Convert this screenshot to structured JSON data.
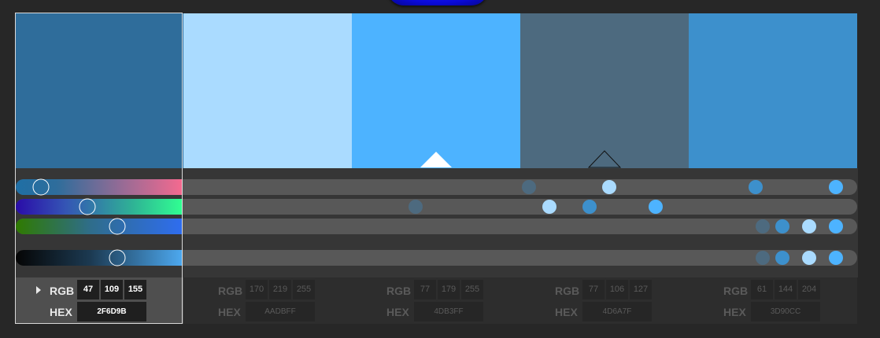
{
  "labels": {
    "rgb": "RGB",
    "hex": "HEX"
  },
  "selected_index": 0,
  "colors": [
    {
      "hex": "2F6D9B",
      "r": "47",
      "g": "109",
      "b": "155",
      "swatch": "#2f6d9b",
      "dot": "#2f6d9b"
    },
    {
      "hex": "AADBFF",
      "r": "170",
      "g": "219",
      "b": "255",
      "swatch": "#aadbff",
      "dot": "#aadbff"
    },
    {
      "hex": "4DB3FF",
      "r": "77",
      "g": "179",
      "b": "255",
      "swatch": "#4db3ff",
      "dot": "#4db3ff"
    },
    {
      "hex": "4D6A7F",
      "r": "77",
      "g": "106",
      "b": "127",
      "swatch": "#4d6a7f",
      "dot": "#4d6a7f"
    },
    {
      "hex": "3D90CC",
      "r": "61",
      "g": "144",
      "b": "204",
      "swatch": "#3d90cc",
      "dot": "#3d90cc"
    }
  ],
  "slider_values": [
    [
      0.15,
      0.64,
      0.98,
      0.52,
      0.86
    ],
    [
      0.43,
      0.55,
      0.71,
      0.35,
      0.61
    ],
    [
      0.61,
      0.94,
      0.98,
      0.87,
      0.9
    ],
    [
      0.61,
      0.94,
      0.98,
      0.87,
      0.9
    ]
  ]
}
